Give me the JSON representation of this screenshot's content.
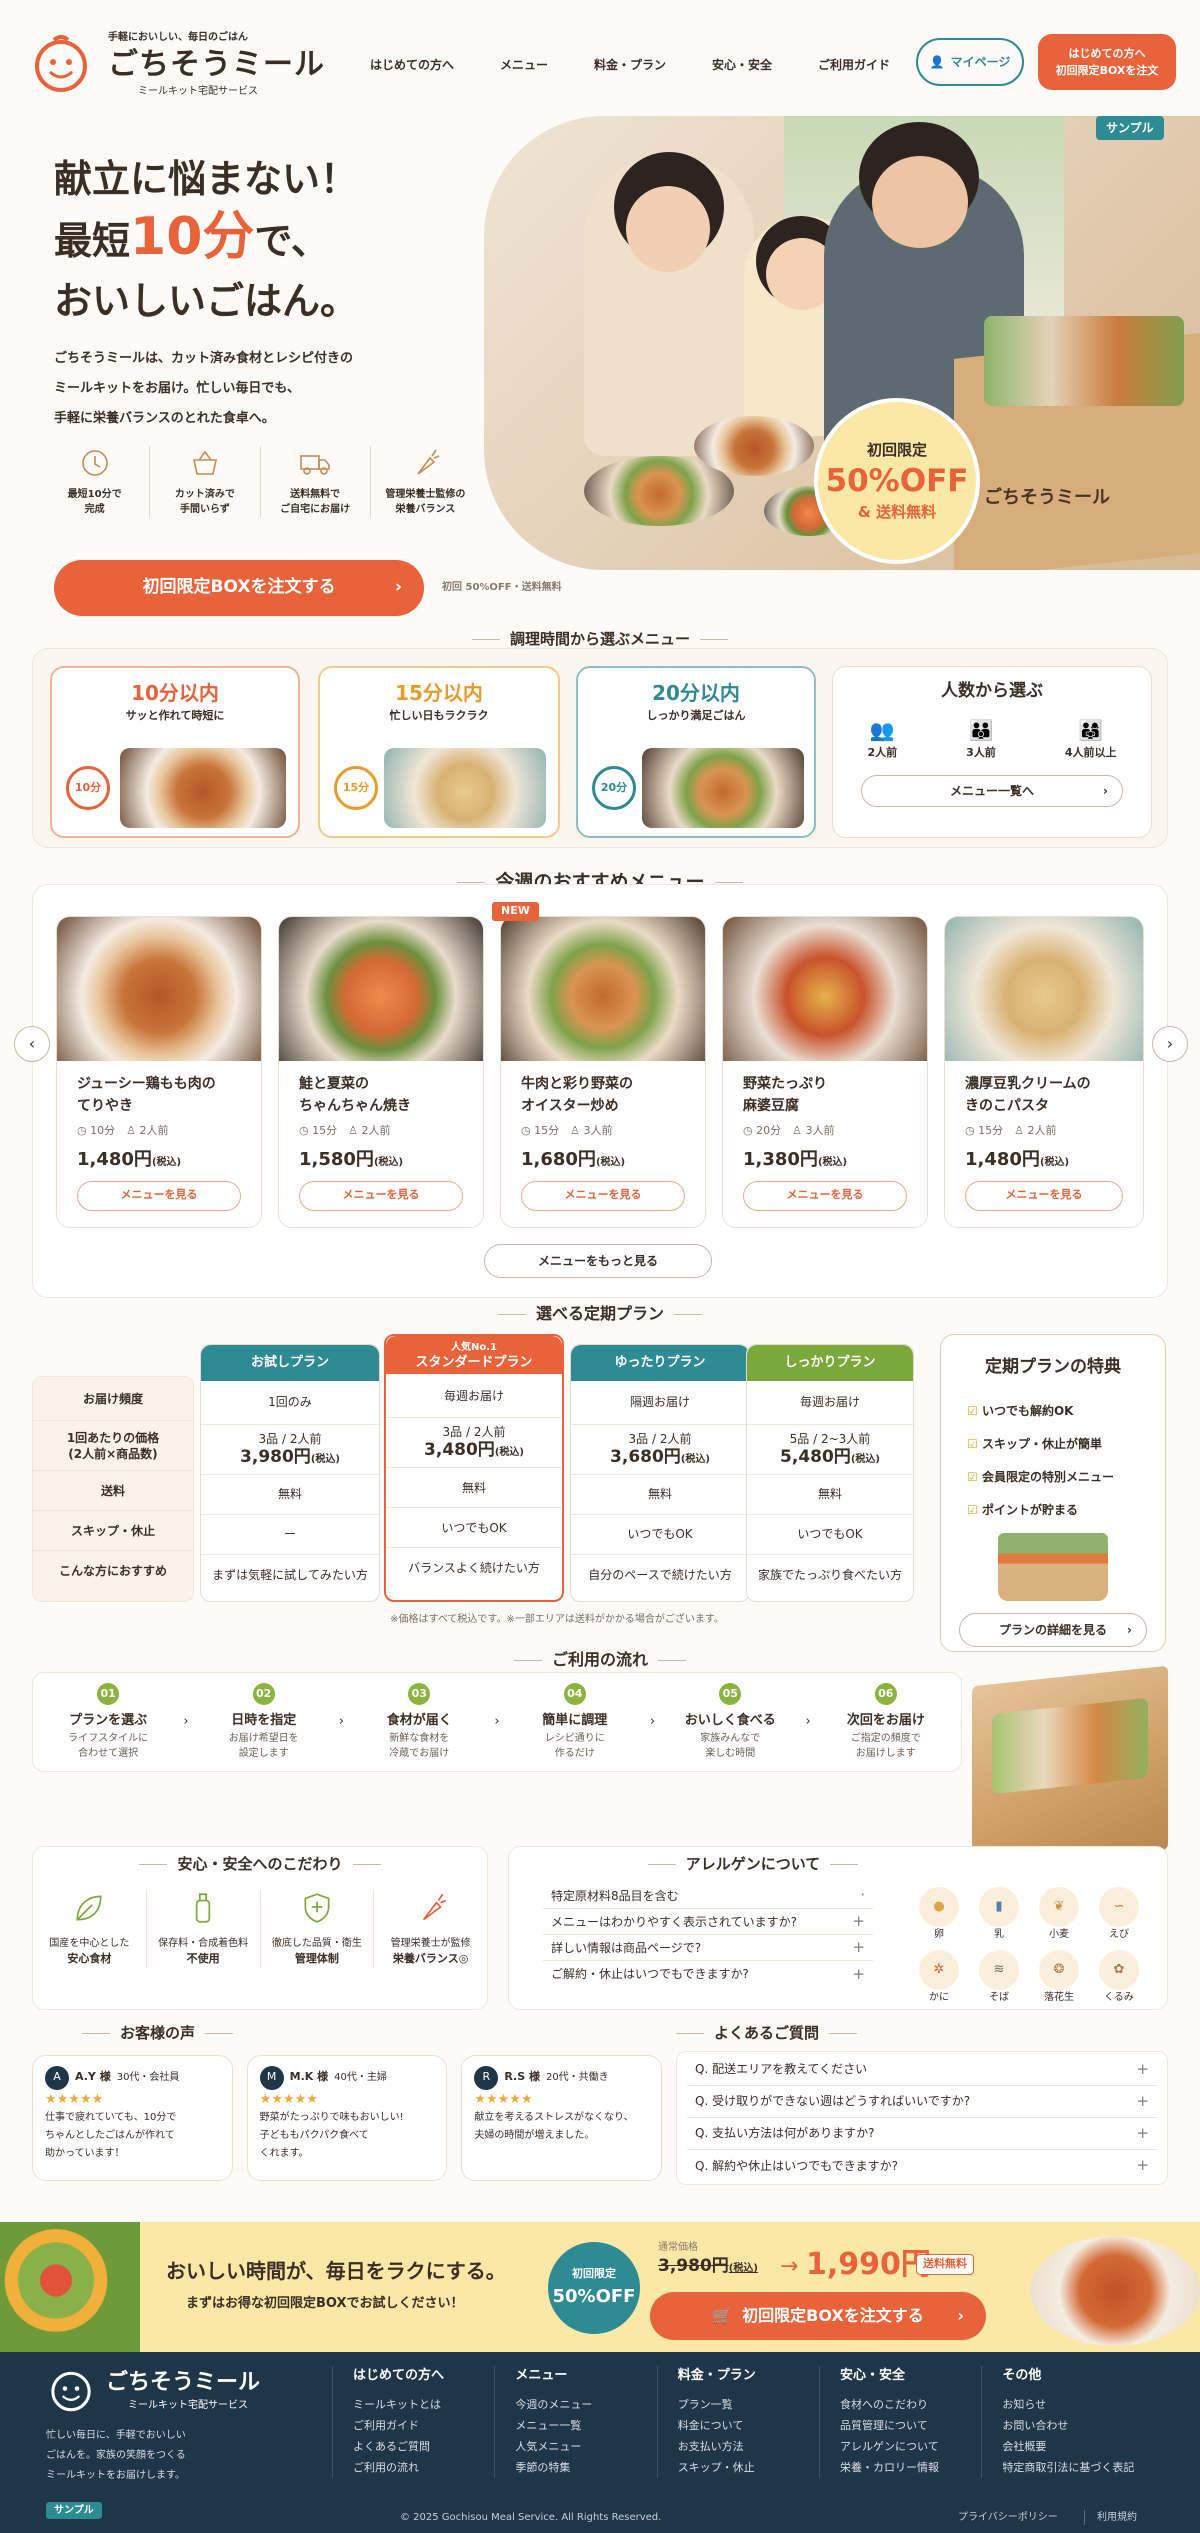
{
  "header": {
    "tagline": "手軽においしい、毎日のごはん",
    "brand": "ごちそうミール",
    "brand_sub": "ミールキット宅配サービス",
    "nav": [
      "はじめての方へ",
      "メニュー",
      "料金・プラン",
      "安心・安全",
      "ご利用ガイド"
    ],
    "mypage": "マイページ",
    "cta_line1": "はじめての方へ",
    "cta_line2": "初回限定BOXを注文"
  },
  "hero": {
    "sample": "サンプル",
    "title1": "献立に悩まない！",
    "title2a": "最短",
    "title2b": "10分",
    "title2c": "で、",
    "title3": "おいしいごはん。",
    "desc1": "ごちそうミールは、カット済み食材とレシピ付きの",
    "desc2": "ミールキットをお届け。忙しい毎日でも、",
    "desc3": "手軽に栄養バランスのとれた食卓へ。",
    "features": [
      {
        "l1": "最短10分で",
        "l2": "完成"
      },
      {
        "l1": "カット済みで",
        "l2": "手間いらず"
      },
      {
        "l1": "送料無料で",
        "l2": "ご自宅にお届け"
      },
      {
        "l1": "管理栄養士監修の",
        "l2": "栄養バランス"
      }
    ],
    "cta": "初回限定BOXを注文する",
    "cta_note": "初回 50%OFF・送料無料",
    "badge_top": "初回限定",
    "badge_mid": "50%OFF",
    "badge_bot": "& 送料無料",
    "box_label": "ごちそうミール"
  },
  "time": {
    "title": "調理時間から選ぶメニュー",
    "cards": [
      {
        "title": "10分以内",
        "sub": "サッと作れて時短に",
        "num": "10分"
      },
      {
        "title": "15分以内",
        "sub": "忙しい日もラクラク",
        "num": "15分"
      },
      {
        "title": "20分以内",
        "sub": "しっかり満足ごはん",
        "num": "20分"
      }
    ],
    "people_title": "人数から選ぶ",
    "people": [
      "2人前",
      "3人前",
      "4人前以上"
    ],
    "people_btn": "メニュー一覧へ"
  },
  "rec": {
    "title": "今週のおすすめメニュー",
    "new": "NEW",
    "items": [
      {
        "n1": "ジューシー鶏もも肉の",
        "n2": "てりやき",
        "min": "10分",
        "ppl": "2人前",
        "price": "1,480円",
        "tax": "(税込)"
      },
      {
        "n1": "鮭と夏菜の",
        "n2": "ちゃんちゃん焼き",
        "min": "15分",
        "ppl": "2人前",
        "price": "1,580円",
        "tax": "(税込)"
      },
      {
        "n1": "牛肉と彩り野菜の",
        "n2": "オイスター炒め",
        "min": "15分",
        "ppl": "3人前",
        "price": "1,680円",
        "tax": "(税込)"
      },
      {
        "n1": "野菜たっぷり",
        "n2": "麻婆豆腐",
        "min": "20分",
        "ppl": "3人前",
        "price": "1,380円",
        "tax": "(税込)"
      },
      {
        "n1": "濃厚豆乳クリームの",
        "n2": "きのこパスタ",
        "min": "15分",
        "ppl": "2人前",
        "price": "1,480円",
        "tax": "(税込)"
      }
    ],
    "item_btn": "メニューを見る",
    "more": "メニューをもっと見る"
  },
  "plans": {
    "title": "選べる定期プラン",
    "rows": [
      "お届け頻度",
      "1回あたりの価格\n(2人前×商品数)",
      "送料",
      "スキップ・休止",
      "こんな方におすすめ"
    ],
    "cols": [
      {
        "head": "お試しプラン",
        "badge": "",
        "color": "#2e8a93",
        "freq": "1回のみ",
        "qty": "3品 / 2人前",
        "price": "3,980円",
        "ship": "無料",
        "skip": "ー",
        "for": "まずは気軽に試してみたい方"
      },
      {
        "head": "スタンダードプラン",
        "badge": "人気No.1",
        "color": "#e8623a",
        "freq": "毎週お届け",
        "qty": "3品 / 2人前",
        "price": "3,480円",
        "ship": "無料",
        "skip": "いつでもOK",
        "for": "バランスよく続けたい方"
      },
      {
        "head": "ゆったりプラン",
        "badge": "",
        "color": "#2e8a93",
        "freq": "隔週お届け",
        "qty": "3品 / 2人前",
        "price": "3,680円",
        "ship": "無料",
        "skip": "いつでもOK",
        "for": "自分のペースで続けたい方"
      },
      {
        "head": "しっかりプラン",
        "badge": "",
        "color": "#7aa83a",
        "freq": "毎週お届け",
        "qty": "5品 / 2~3人前",
        "price": "5,480円",
        "ship": "無料",
        "skip": "いつでもOK",
        "for": "家族でたっぷり食べたい方"
      }
    ],
    "tax": "(税込)",
    "note": "※価格はすべて税込です。※一部エリアは送料がかかる場合がございます。",
    "benefit_title": "定期プランの特典",
    "benefits": [
      "いつでも解約OK",
      "スキップ・休止が簡単",
      "会員限定の特別メニュー",
      "ポイントが貯まる"
    ],
    "benefit_btn": "プランの詳細を見る"
  },
  "flow": {
    "title": "ご利用の流れ",
    "steps": [
      {
        "n": "01",
        "t": "プランを選ぶ",
        "d1": "ライフスタイルに",
        "d2": "合わせて選択"
      },
      {
        "n": "02",
        "t": "日時を指定",
        "d1": "お届け希望日を",
        "d2": "設定します"
      },
      {
        "n": "03",
        "t": "食材が届く",
        "d1": "新鮮な食材を",
        "d2": "冷蔵でお届け"
      },
      {
        "n": "04",
        "t": "簡単に調理",
        "d1": "レシピ通りに",
        "d2": "作るだけ"
      },
      {
        "n": "05",
        "t": "おいしく食べる",
        "d1": "家族みんなで",
        "d2": "楽しむ時間"
      },
      {
        "n": "06",
        "t": "次回をお届け",
        "d1": "ご指定の頻度で",
        "d2": "お届けします"
      }
    ]
  },
  "safety": {
    "title": "安心・安全へのこだわり",
    "items": [
      {
        "l1": "国産を中心とした",
        "l2": "安心食材"
      },
      {
        "l1": "保存料・合成着色料",
        "l2": "不使用"
      },
      {
        "l1": "徹底した品質・衛生",
        "l2": "管理体制"
      },
      {
        "l1": "管理栄養士が監修",
        "l2": "栄養バランス◎"
      }
    ]
  },
  "allergen": {
    "title": "アレルゲンについて",
    "rows": [
      "特定原材料8品目を含む",
      "メニューはわかりやすく表示されていますか?",
      "詳しい情報は商品ページで?",
      "ご解約・休止はいつでもできますか?"
    ],
    "icons": [
      "卵",
      "乳",
      "小麦",
      "えび",
      "かに",
      "そば",
      "落花生",
      "くるみ"
    ]
  },
  "voice": {
    "title": "お客様の声",
    "items": [
      {
        "init": "A",
        "name": "A.Y 様",
        "meta": "30代・会社員",
        "stars": "★★★★★",
        "t1": "仕事で疲れていても、10分で",
        "t2": "ちゃんとしたごはんが作れて",
        "t3": "助かっています！"
      },
      {
        "init": "M",
        "name": "M.K 様",
        "meta": "40代・主婦",
        "stars": "★★★★★",
        "t1": "野菜がたっぷりで味もおいしい!",
        "t2": "子どももパクパク食べて",
        "t3": "くれます。"
      },
      {
        "init": "R",
        "name": "R.S 様",
        "meta": "20代・共働き",
        "stars": "★★★★★",
        "t1": "献立を考えるストレスがなくなり、",
        "t2": "夫婦の時間が増えました。",
        "t3": ""
      }
    ]
  },
  "faq": {
    "title": "よくあるご質問",
    "items": [
      "Q. 配送エリアを教えてください",
      "Q. 受け取りができない週はどうすればいいですか?",
      "Q. 支払い方法は何がありますか?",
      "Q. 解約や休止はいつでもできますか?"
    ]
  },
  "banner": {
    "title": "おいしい時間が、毎日をラクにする。",
    "sub": "まずはお得な初回限定BOXでお試しください！",
    "badge_top": "初回限定",
    "badge_bot": "50%OFF",
    "before_label": "通常価格",
    "before": "3,980円",
    "tax": "(税込)",
    "after": "1,990円",
    "free": "送料無料",
    "cta": "初回限定BOXを注文する"
  },
  "footer": {
    "brand": "ごちそうミール",
    "brand_sub": "ミールキット宅配サービス",
    "desc1": "忙しい毎日に、手軽でおいしい",
    "desc2": "ごはんを。家族の笑顔をつくる",
    "desc3": "ミールキットをお届けします。",
    "sample": "サンプル",
    "cols": [
      {
        "h": "はじめての方へ",
        "l": [
          "ミールキットとは",
          "ご利用ガイド",
          "よくあるご質問",
          "ご利用の流れ"
        ]
      },
      {
        "h": "メニュー",
        "l": [
          "今週のメニュー",
          "メニュー一覧",
          "人気メニュー",
          "季節の特集"
        ]
      },
      {
        "h": "料金・プラン",
        "l": [
          "プラン一覧",
          "料金について",
          "お支払い方法",
          "スキップ・休止"
        ]
      },
      {
        "h": "安心・安全",
        "l": [
          "食材へのこだわり",
          "品質管理について",
          "アレルゲンについて",
          "栄養・カロリー情報"
        ]
      },
      {
        "h": "その他",
        "l": [
          "お知らせ",
          "お問い合わせ",
          "会社概要",
          "特定商取引法に基づく表記"
        ]
      }
    ],
    "copy": "© 2025 Gochisou Meal Service. All Rights Reserved.",
    "privacy": "プライバシーポリシー",
    "terms": "利用規約"
  },
  "colors": {
    "accent": "#e8623a",
    "teal": "#2e8a93",
    "green": "#7aa83a",
    "navy": "#1f3548",
    "cream": "#fbe7a6"
  }
}
